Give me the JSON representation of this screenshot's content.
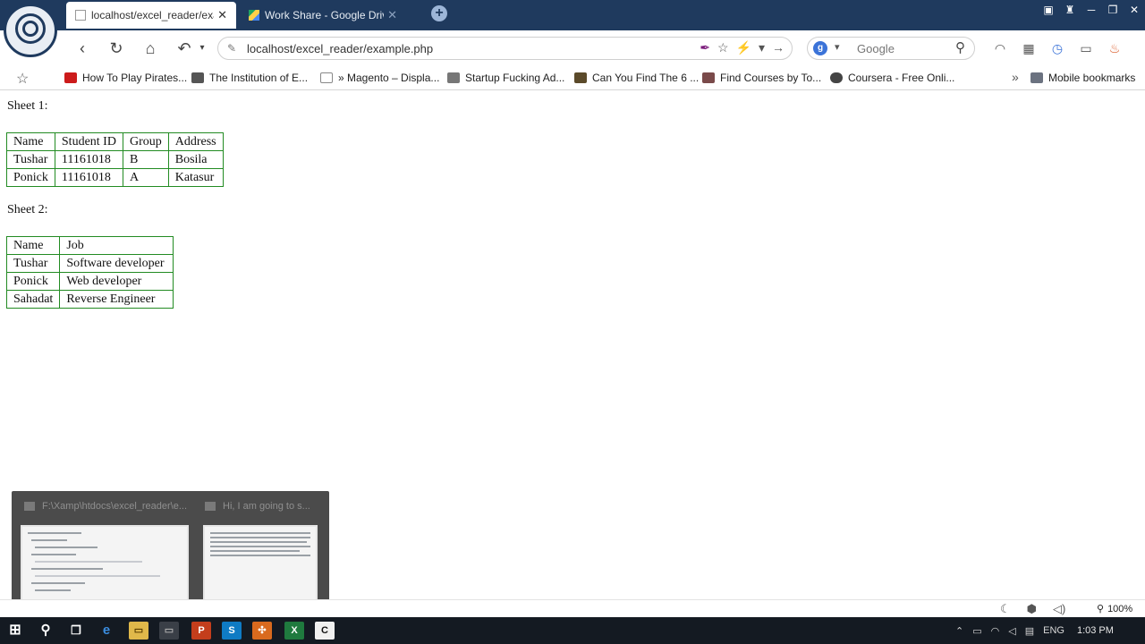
{
  "browser": {
    "tabs": [
      {
        "title": "localhost/excel_reader/exa",
        "close": "✕"
      },
      {
        "title": "Work Share - Google Drive",
        "close": "✕"
      }
    ],
    "new_tab": "+",
    "window_controls": [
      "▣",
      "♜",
      "─",
      "❐",
      "✕"
    ],
    "address": "localhost/excel_reader/example.php",
    "search_engine": "Google",
    "search_placeholder": "Google"
  },
  "bookmarks": [
    {
      "label": "How To Play Pirates...",
      "color": "#cc1b1b"
    },
    {
      "label": "The Institution of E...",
      "color": "#555555"
    },
    {
      "label": "» Magento – Displa...",
      "color": "#dddddd"
    },
    {
      "label": "Startup Fucking Ad...",
      "color": "#777777"
    },
    {
      "label": "Can You Find The 6 ...",
      "color": "#5b4a2a"
    },
    {
      "label": "Find Courses by To...",
      "color": "#7a4a4a"
    },
    {
      "label": "Coursera - Free Onli...",
      "color": "#444444"
    }
  ],
  "bookmarks_more": "»",
  "mobile_bookmarks": "Mobile bookmarks",
  "page": {
    "sheet1_label": "Sheet 1:",
    "sheet1": [
      [
        "Name",
        "Student ID",
        "Group",
        "Address"
      ],
      [
        "Tushar",
        "11161018",
        "B",
        "Bosila"
      ],
      [
        "Ponick",
        "11161018",
        "A",
        "Katasur"
      ]
    ],
    "sheet2_label": "Sheet 2:",
    "sheet2": [
      [
        "Name",
        "Job"
      ],
      [
        "Tushar",
        "Software developer"
      ],
      [
        "Ponick",
        "Web developer"
      ],
      [
        "Sahadat",
        "Reverse Engineer"
      ]
    ]
  },
  "task_previews": [
    {
      "title": "F:\\Xamp\\htdocs\\excel_reader\\e..."
    },
    {
      "title": "Hi, I am going to s..."
    }
  ],
  "status": {
    "zoom": "100%"
  },
  "taskbar": {
    "language": "ENG",
    "time": "1:03 PM"
  },
  "colors": {
    "table_border": "#228b22",
    "titlebar": "#1f3a5e",
    "taskbar": "#141a22"
  }
}
